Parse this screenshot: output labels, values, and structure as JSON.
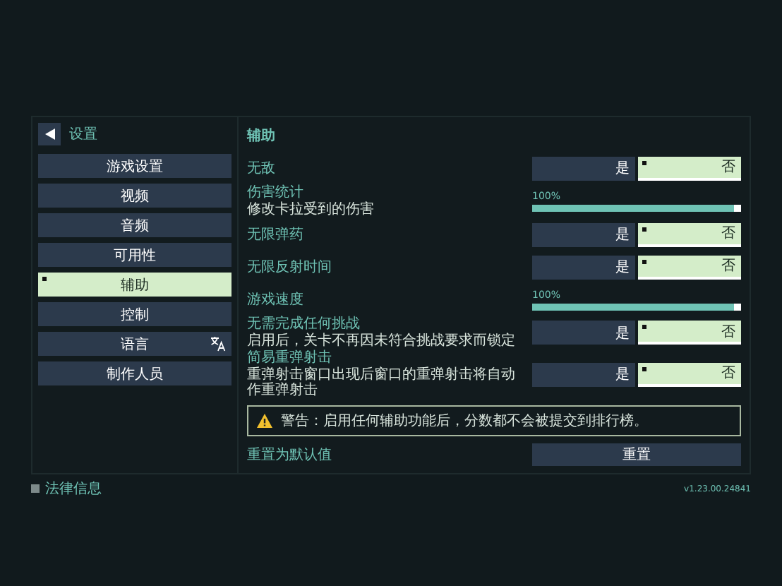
{
  "sidebar": {
    "title": "设置",
    "items": [
      {
        "label": "游戏设置",
        "selected": false
      },
      {
        "label": "视频",
        "selected": false
      },
      {
        "label": "音频",
        "selected": false
      },
      {
        "label": "可用性",
        "selected": false
      },
      {
        "label": "辅助",
        "selected": true
      },
      {
        "label": "控制",
        "selected": false
      },
      {
        "label": "语言",
        "selected": false,
        "kind": "language"
      },
      {
        "label": "制作人员",
        "selected": false
      }
    ]
  },
  "panel": {
    "title": "辅助",
    "settings": [
      {
        "kind": "toggle",
        "label": "无敌",
        "options": [
          {
            "label": "是",
            "selected": false
          },
          {
            "label": "否",
            "selected": true
          }
        ]
      },
      {
        "kind": "slider",
        "label": "伤害统计",
        "description": "修改卡拉受到的伤害",
        "reading": "100%",
        "level": 1
      },
      {
        "kind": "toggle",
        "label": "无限弹药",
        "options": [
          {
            "label": "是",
            "selected": false
          },
          {
            "label": "否",
            "selected": true
          }
        ]
      },
      {
        "kind": "toggle",
        "label": "无限反射时间",
        "options": [
          {
            "label": "是",
            "selected": false
          },
          {
            "label": "否",
            "selected": true
          }
        ]
      },
      {
        "kind": "slider",
        "label": "游戏速度",
        "reading": "100%",
        "level": 1
      },
      {
        "kind": "toggle",
        "label": "无需完成任何挑战",
        "description": "启用后，关卡不再因未符合挑战要求而锁定",
        "options": [
          {
            "label": "是",
            "selected": false
          },
          {
            "label": "否",
            "selected": true
          }
        ]
      },
      {
        "kind": "toggle",
        "label": "简易重弹射击",
        "description": "重弹射击窗口出现后窗口的重弹射击将自动作重弹射击",
        "options": [
          {
            "label": "是",
            "selected": false
          },
          {
            "label": "否",
            "selected": true
          }
        ]
      }
    ],
    "warning": "警告：启用任何辅助功能后，分数都不会被提交到排行榜。",
    "reset": {
      "label": "重置为默认值",
      "button": "重置"
    }
  },
  "footer": {
    "legal": "法律信息",
    "version": "v1.23.00.24841"
  }
}
